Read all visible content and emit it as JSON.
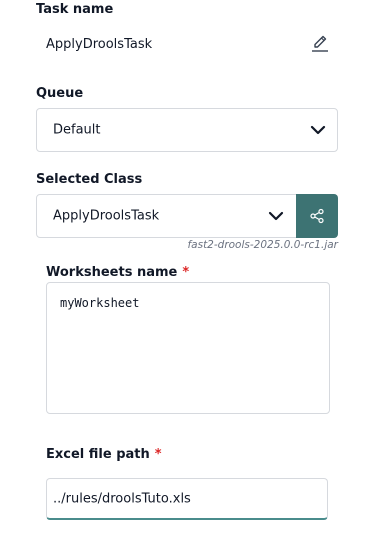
{
  "task_name": {
    "label": "Task name",
    "value": "ApplyDroolsTask",
    "edit_icon": "pencil-icon"
  },
  "queue": {
    "label": "Queue",
    "selected": "Default"
  },
  "selected_class": {
    "label": "Selected Class",
    "selected": "ApplyDroolsTask",
    "action_icon": "share-icon",
    "jar": "fast2-drools-2025.0.0-rc1.jar"
  },
  "worksheets_name": {
    "label": "Worksheets name",
    "required_mark": "*",
    "value": "myWorksheet"
  },
  "excel_file_path": {
    "label": "Excel file path",
    "required_mark": "*",
    "value": "../rules/droolsTuto.xls"
  },
  "colors": {
    "accent": "#3d7373",
    "required": "#dc2626",
    "border": "#d6d9de"
  }
}
